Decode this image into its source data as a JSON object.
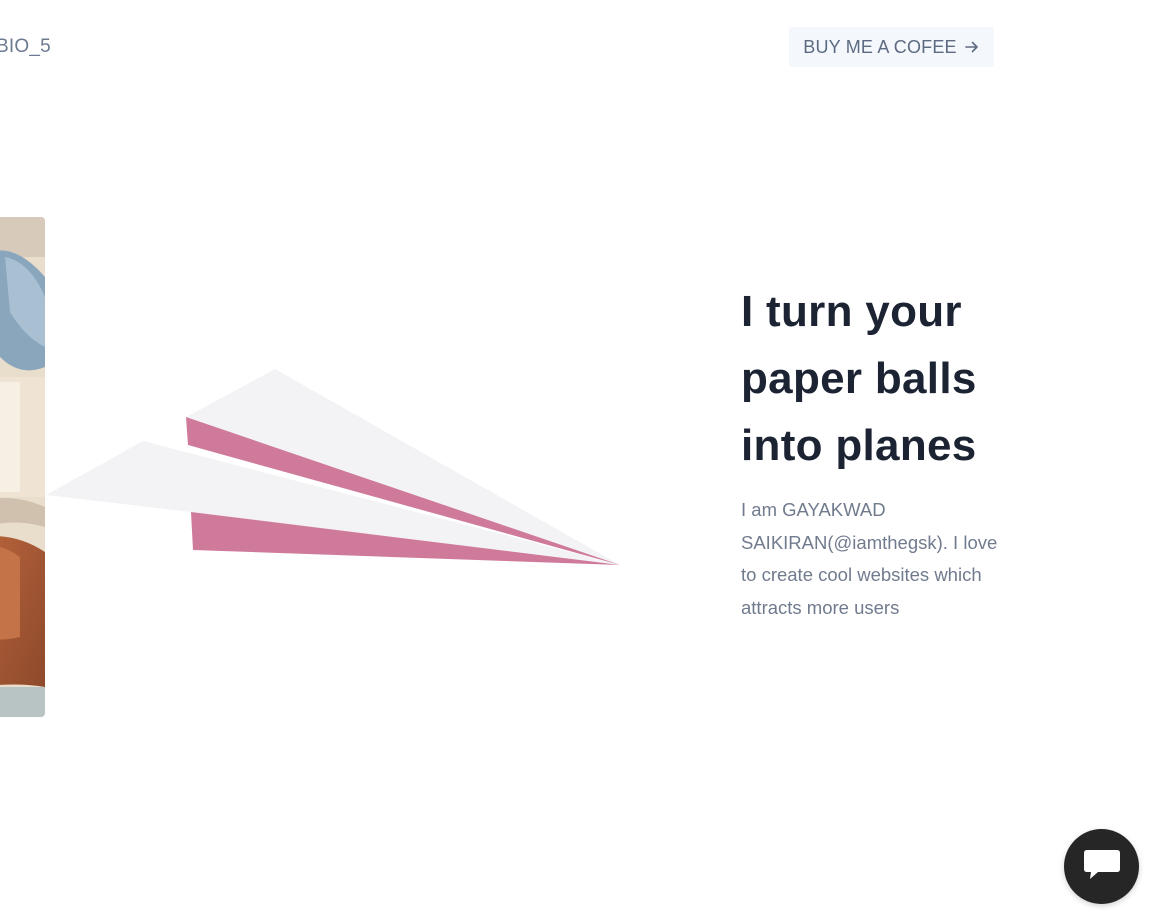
{
  "header": {
    "brand": "BIO_5",
    "coffee_label": "BUY ME A COFEE",
    "coffee_icon": "arrow-right-icon"
  },
  "hero": {
    "headline_lines": [
      "I turn your",
      "paper balls",
      "into planes"
    ],
    "bio": "I am GAYAKWAD SAIKIRAN(@iamthegsk). I love to create cool websites which attracts more users",
    "illustration": "paper-plane",
    "colors": {
      "plane_white": "#f3f3f6",
      "plane_accent": "#cf7a9a"
    }
  },
  "chat": {
    "icon": "chat-bubble-icon",
    "color": "#262626"
  }
}
